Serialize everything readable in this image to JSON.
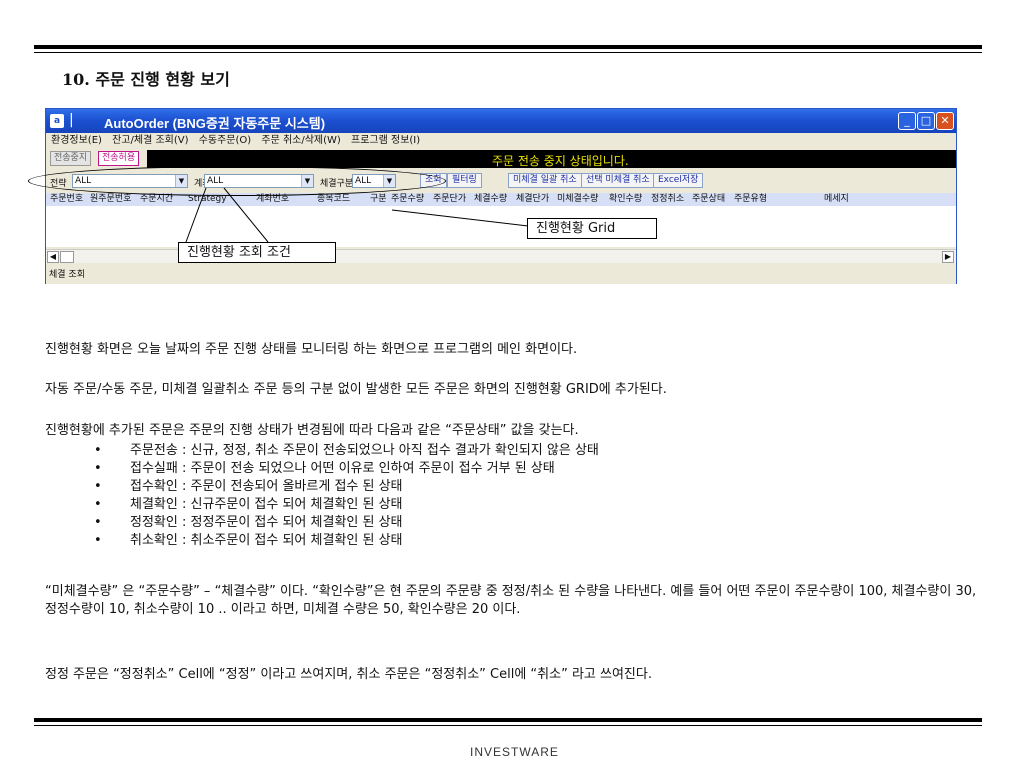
{
  "doc_title": "10. 주문 진행 현황 보기",
  "window": {
    "title": "AutoOrder (BNG증권 자동주문 시스템)",
    "icon_glyph": "a",
    "separator": "|",
    "buttons": {
      "minimize": "_",
      "maximize": "□",
      "close": "✕"
    },
    "menu": [
      "환경정보(E)",
      "잔고/체결 조회(V)",
      "수동주문(O)",
      "주문 취소/삭제(W)",
      "프로그램 정보(I)"
    ],
    "status_buttons": [
      "전송중지",
      "전송허용"
    ],
    "status_message": "주문 전송 중지 상태입니다.",
    "filters": {
      "strategy_label": "전략",
      "strategy_value": "ALL",
      "account_label": "계좌번호",
      "account_value": "ALL",
      "settle_label": "체결구분",
      "settle_value": "ALL",
      "dropdown_arrow": "▼"
    },
    "action_buttons": [
      "조회",
      "필터링",
      "미체결 일괄 취소",
      "선택 미체결 취소",
      "Excel저장"
    ],
    "grid_columns": [
      "주문번호",
      "원주문번호",
      "주문시간",
      "Strategy",
      "계좌번호",
      "종목코드",
      "구분",
      "주문수량",
      "주문단가",
      "체결수량",
      "체결단가",
      "미체결수량",
      "확인수량",
      "정정취소",
      "주문상태",
      "주문유형",
      "메세지"
    ],
    "scroll_left": "◀",
    "scroll_right": "▶",
    "statusbar_text": "체결 조회"
  },
  "callouts": {
    "filter": "진행현황 조회 조건",
    "grid": "진행현황 Grid"
  },
  "paragraphs": {
    "p1": "진행현황 화면은 오늘 날짜의 주문 진행 상태를 모니터링 하는 화면으로 프로그램의 메인 화면이다.",
    "p2": "자동 주문/수동 주문, 미체결 일괄취소 주문 등의 구분 없이 발생한 모든 주문은 화면의 진행현황 GRID에 추가된다.",
    "p3": "진행현황에 추가된 주문은 주문의 진행 상태가 변경됨에 따라 다음과 같은 “주문상태” 값을 갖는다.",
    "p4": "“미체결수량” 은 “주문수량” – “체결수량” 이다. “확인수량”은 현 주문의 주문량 중 정정/취소 된 수량을 나타낸다. 예를 들어 어떤 주문이 주문수량이 100, 체결수량이 30, 정정수량이 10, 취소수량이 10 .. 이라고 하면, 미체결 수량은 50, 확인수량은 20 이다.",
    "p5": "정정 주문은 “정정취소” Cell에 “정정” 이라고 쓰여지며, 취소 주문은 “정정취소” Cell에 “취소” 라고 쓰여진다."
  },
  "status_list": [
    "주문전송 : 신규, 정정, 취소 주문이 전송되었으나 아직 접수 결과가 확인되지 않은 상태",
    "접수실패 : 주문이 전송 되었으나 어떤 이유로 인하여 주문이 접수 거부 된 상태",
    "접수확인 : 주문이 전송되어 올바르게 접수 된 상태",
    "체결확인 : 신규주문이 접수 되어 체결확인 된 상태",
    "정정확인 : 정정주문이 접수 되어 체결확인 된 상태",
    "취소확인 : 취소주문이 접수 되어 체결확인 된 상태"
  ],
  "footer": {
    "logo": "INVESTWARE"
  }
}
